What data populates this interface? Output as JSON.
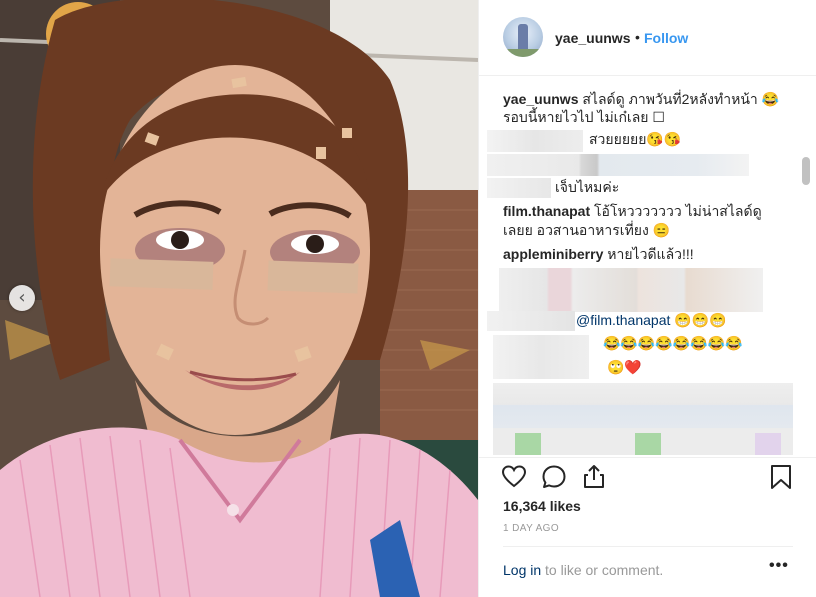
{
  "photo": {
    "prev_arrow": "‹"
  },
  "header": {
    "username": "yae_uunws",
    "separator": "•",
    "follow_label": "Follow"
  },
  "caption": {
    "username": "yae_uunws",
    "line1": "สไลด์ดู ภาพวันที่2หลังทำหน้า 😂",
    "line2": "รอบนี้หายไวไป ไม่เก๋เลย ☐"
  },
  "comments": [
    {
      "username": "",
      "text": "สวยยยยย😘😘"
    },
    {
      "username": "",
      "text": "เจ็บไหมค่ะ"
    },
    {
      "username": "film.thanapat",
      "text": "โอ้โหววววววว ไม่น่าสไลด์ดู",
      "text2": "เลยย อวสานอาหารเที่ยง 😑"
    },
    {
      "username": "appleminiberry",
      "text": "หายไวดีแล้ว!!!"
    },
    {
      "username": "",
      "mention": "@film.thanapat",
      "text": "😁😁😁"
    },
    {
      "username": "",
      "text": "😂😂😂😂😂😂😂😂"
    },
    {
      "username": "",
      "text": "🙄❤️"
    }
  ],
  "actions": {
    "like_icon": "heart-icon",
    "comment_icon": "comment-bubble-icon",
    "share_icon": "share-icon",
    "save_icon": "bookmark-icon",
    "likes_count": "16,364 likes",
    "time_ago": "1 DAY AGO",
    "login_link": "Log in",
    "login_suffix": " to like or comment.",
    "more_label": "•••"
  },
  "colors": {
    "link": "#3897f0",
    "text": "#262626",
    "muted": "#999999",
    "mention": "#003569"
  }
}
